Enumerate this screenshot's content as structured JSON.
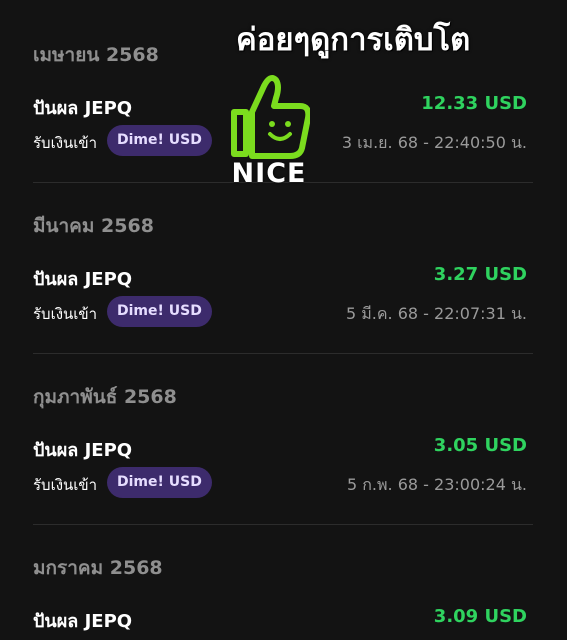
{
  "overlay": {
    "title": "ค่อยๆดูการเติบโต",
    "sticker_text": "NICE",
    "sticker_color": "#7bdc1e"
  },
  "colors": {
    "background": "#131313",
    "amount_green": "#2fd35f",
    "badge_bg": "#3d2b6c",
    "month_gray": "#8f8f8f"
  },
  "feed": {
    "sections": [
      {
        "month": "เมษายน 2568",
        "title": "ปันผล JEPQ",
        "amount": "12.33 USD",
        "type": "รับเงินเข้า",
        "badge": "Dime! USD",
        "datetime": "3 เม.ย. 68 - 22:40:50 น."
      },
      {
        "month": "มีนาคม 2568",
        "title": "ปันผล JEPQ",
        "amount": "3.27 USD",
        "type": "รับเงินเข้า",
        "badge": "Dime! USD",
        "datetime": "5 มี.ค. 68 - 22:07:31 น."
      },
      {
        "month": "กุมภาพันธ์ 2568",
        "title": "ปันผล JEPQ",
        "amount": "3.05 USD",
        "type": "รับเงินเข้า",
        "badge": "Dime! USD",
        "datetime": "5 ก.พ. 68 - 23:00:24 น."
      },
      {
        "month": "มกราคม 2568",
        "title": "ปันผล JEPQ",
        "amount": "3.09 USD"
      }
    ]
  }
}
